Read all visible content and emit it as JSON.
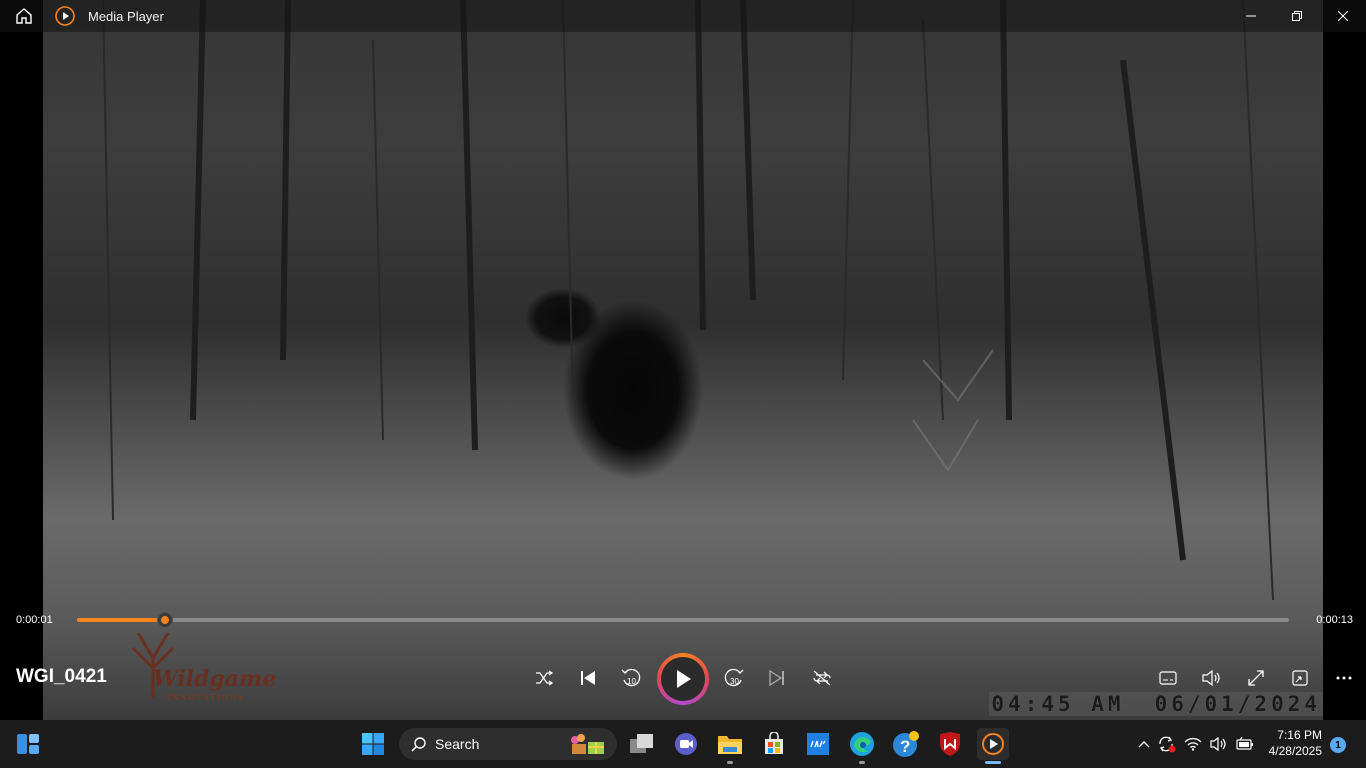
{
  "app": {
    "title": "Media Player"
  },
  "video": {
    "timestamp_time": "04:45 AM",
    "timestamp_date": "06/01/2024",
    "logo_text": "Wildgame",
    "logo_subtext": "INNOVATIONS"
  },
  "player": {
    "media_title": "WGI_0421",
    "current_time": "0:00:01",
    "duration": "0:00:13",
    "progress_fraction": 0.073,
    "seek_back_label": "10",
    "seek_forward_label": "30",
    "accent_color": "#f7831f"
  },
  "taskbar": {
    "search_label": "Search",
    "clock_time": "7:16 PM",
    "clock_date": "4/28/2025",
    "notification_count": "1"
  }
}
